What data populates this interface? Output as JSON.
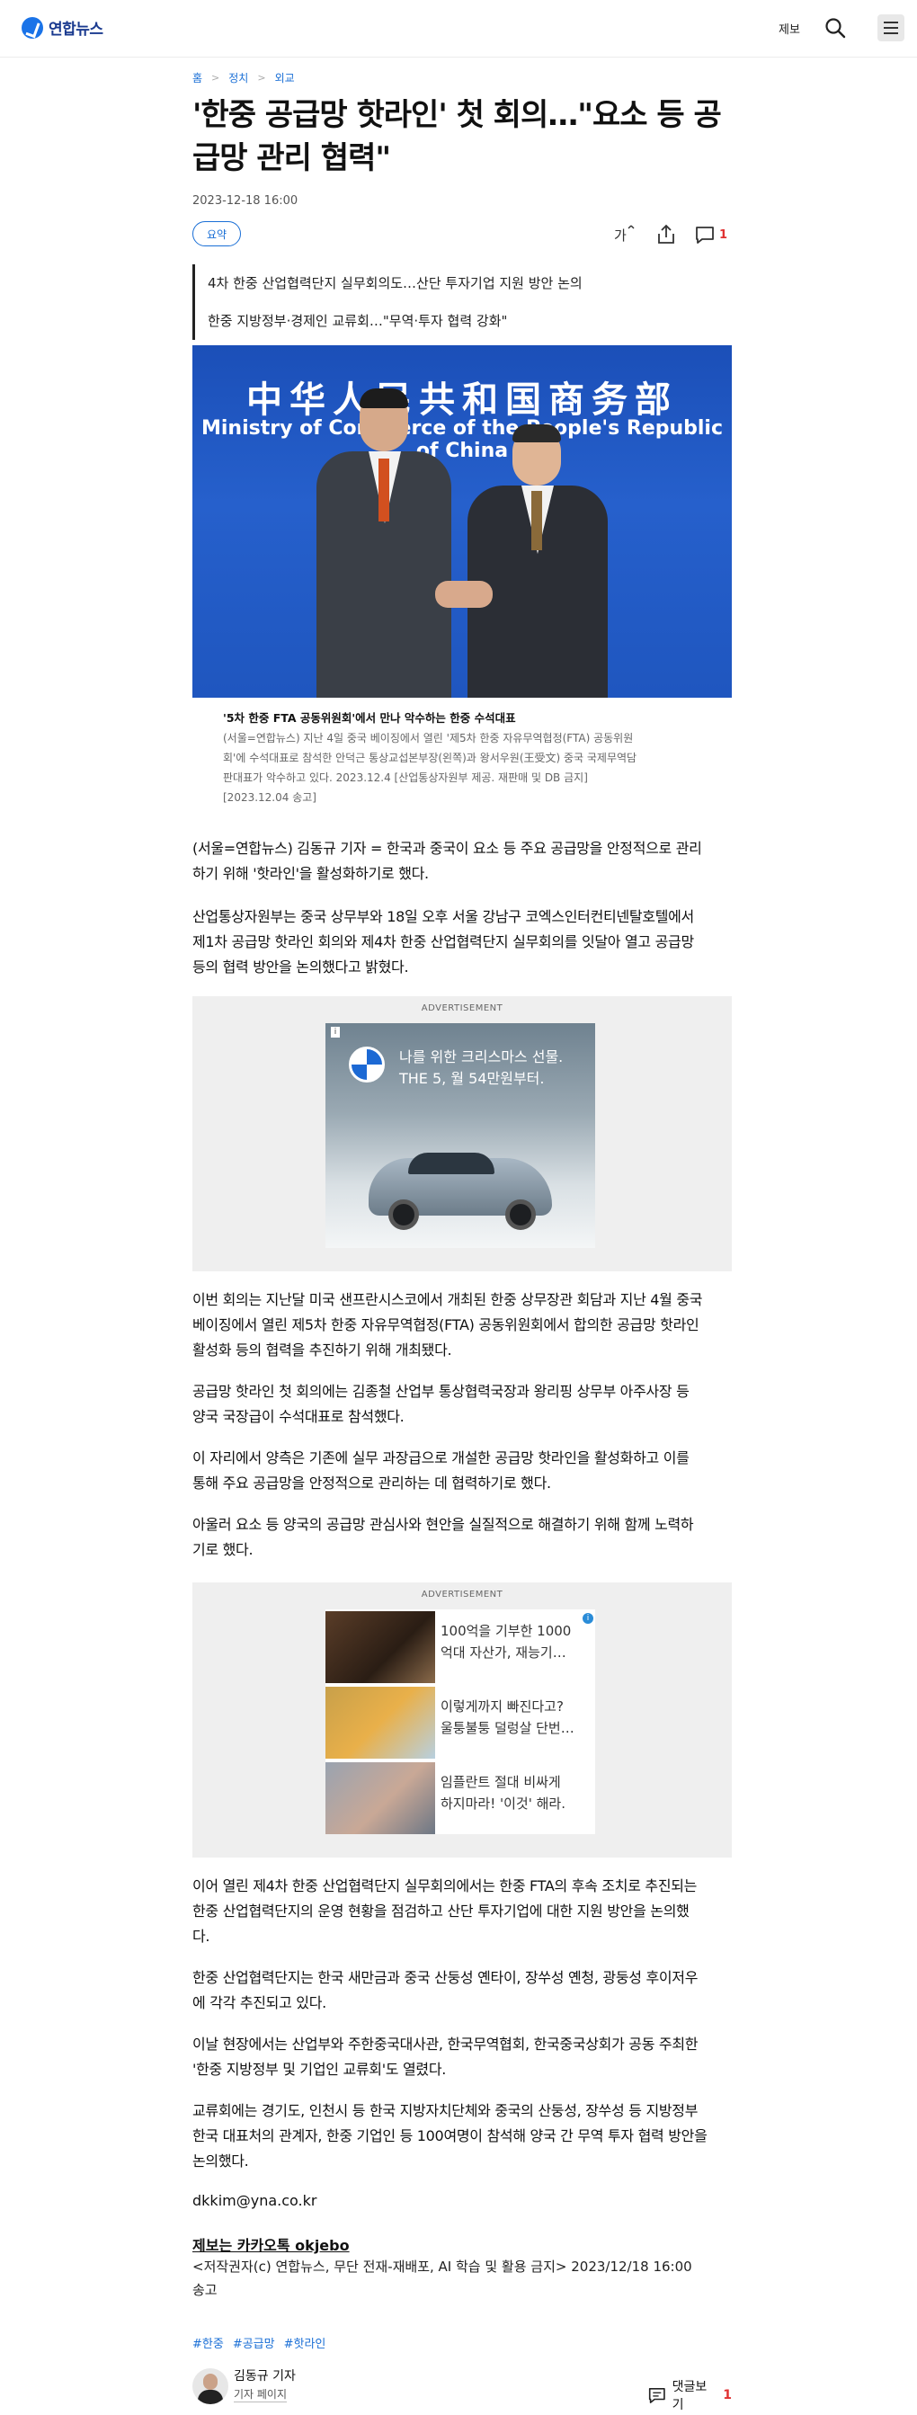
{
  "header": {
    "logo_text": "연합뉴스",
    "report_label": "제보"
  },
  "breadcrumb": [
    "홈",
    "정치",
    "외교"
  ],
  "article": {
    "title": "'한중 공급망 핫라인' 첫 회의…\"요소 등 공급망 관리 협력\"",
    "title_line1": "'한중 공급망 핫라인' 첫 회의…\"요소 등 공",
    "title_line2": "급망 관리 협력\"",
    "date": "2023-12-18 16:00",
    "summary_label": "요약",
    "font_icon_label": "가",
    "comment_count": "1",
    "subheads": [
      "4차 한중 산업협력단지 실무회의도…산단 투자기업 지원 방안 논의",
      "한중 지방정부·경제인 교류회…\"무역·투자 협력 강화\""
    ],
    "photo": {
      "banner_cn": "中华人民共和国商务部",
      "banner_en": "Ministry of Commerce of the People's Republic of China",
      "caption_title": "'5차 한중 FTA 공동위원회'에서 만나 악수하는 한중 수석대표",
      "caption_lines": [
        "(서울=연합뉴스) 지난 4일 중국 베이징에서 열린 '제5차 한중 자유무역협정(FTA) 공동위원",
        "회'에 수석대표로 참석한 안덕근 통상교섭본부장(왼쪽)과 왕서우원(王受文) 중국 국제무역담",
        "판대표가 악수하고 있다. 2023.12.4 [산업통상자원부 제공. 재판매 및 DB 금지]",
        "[2023.12.04 송고]"
      ]
    },
    "paragraphs": [
      [
        "(서울=연합뉴스) 김동규 기자 = 한국과 중국이 요소 등 주요 공급망을 안정적으로 관리",
        "하기 위해 '핫라인'을 활성화하기로 했다."
      ],
      [
        "산업통상자원부는 중국 상무부와 18일 오후 서울 강남구 코엑스인터컨티넨탈호텔에서",
        "제1차 공급망 핫라인 회의와 제4차 한중 산업협력단지 실무회의를 잇달아 열고 공급망",
        "등의 협력 방안을 논의했다고 밝혔다."
      ],
      [
        "이번 회의는 지난달 미국 샌프란시스코에서 개최된 한중 상무장관 회담과 지난 4월 중국",
        "베이징에서 열린 제5차 한중 자유무역협정(FTA) 공동위원회에서 합의한 공급망 핫라인",
        "활성화 등의 협력을 추진하기 위해 개최됐다."
      ],
      [
        "공급망 핫라인 첫 회의에는 김종철 산업부 통상협력국장과 왕리핑 상무부 아주사장 등",
        "양국 국장급이 수석대표로 참석했다."
      ],
      [
        "이 자리에서 양측은 기존에 실무 과장급으로 개설한 공급망 핫라인을 활성화하고 이를",
        "통해 주요 공급망을 안정적으로 관리하는 데 협력하기로 했다."
      ],
      [
        "아울러 요소 등 양국의 공급망 관심사와 현안을 실질적으로 해결하기 위해 함께 노력하",
        "기로 했다."
      ],
      [
        "이어 열린 제4차 한중 산업협력단지 실무회의에서는 한중 FTA의 후속 조치로 추진되는",
        "한중 산업협력단지의 운영 현황을 점검하고 산단 투자기업에 대한 지원 방안을 논의했",
        "다."
      ],
      [
        "한중 산업협력단지는 한국 새만금과 중국 산둥성 옌타이, 장쑤성 옌청, 광둥성 후이저우",
        "에 각각 추진되고 있다."
      ],
      [
        "이날 현장에서는 산업부와 주한중국대사관, 한국무역협회, 한국중국상회가 공동 주최한",
        "'한중 지방정부 및 기업인 교류회'도 열렸다."
      ],
      [
        "교류회에는 경기도, 인천시 등 한국 지방자치단체와 중국의 산둥성, 장쑤성 등 지방정부",
        "한국 대표처의 관계자, 한중 기업인 등 100여명이 참석해 양국 간 무역 투자 협력 방안을",
        "논의했다."
      ]
    ],
    "email": "dkkim@yna.co.kr",
    "tip": "제보는 카카오톡 okjebo",
    "copyright_line1": "<저작권자(c) 연합뉴스, 무단 전재-재배포, AI 학습 및 활용 금지>  2023/12/18 16:00",
    "copyright_line2": "송고",
    "tags": [
      "#한중",
      "#공급망",
      "#핫라인"
    ],
    "reporter_name": "김동규 기자",
    "reporter_page": "기자 페이지",
    "comment_button": "댓글보기",
    "comment_button_count": "1"
  },
  "ads": {
    "label": "ADVERTISEMENT",
    "ad1_info": "i",
    "ad1_line1": "나를 위한 크리스마스 선물.",
    "ad1_line2": "THE 5, 월 54만원부터.",
    "ad2_info": "i",
    "ad2_items": [
      [
        "100억을 기부한 1000",
        "억대 자산가, 재능기…"
      ],
      [
        "이렇게까지 빠진다고?",
        "울퉁불퉁 덜렁살 단번…"
      ],
      [
        "임플란트 절대 비싸게",
        "하지마라! '이것' 해라."
      ]
    ]
  }
}
